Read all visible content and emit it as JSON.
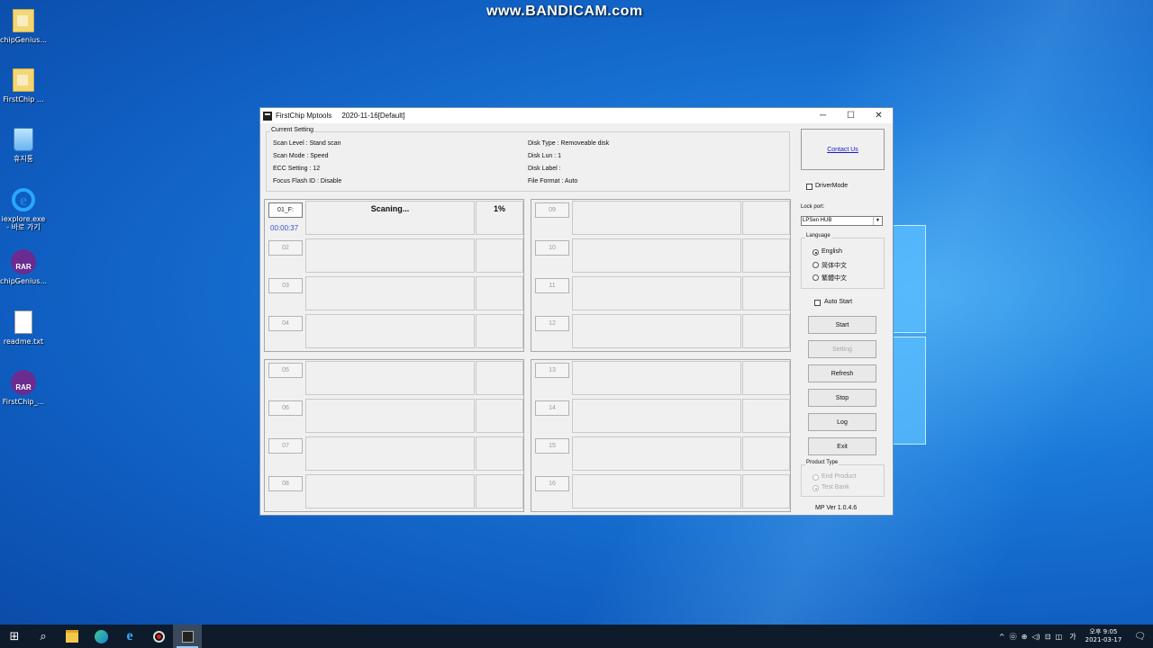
{
  "watermark": "www.BANDICAM.com",
  "desktop_icons": [
    {
      "label": "chipGenius...",
      "icon": "folder-icon"
    },
    {
      "label": "FirstChip ...",
      "icon": "folder-icon"
    },
    {
      "label": "휴지통",
      "icon": "recycle-bin-icon"
    },
    {
      "label": "iexplore.exe - 바로 가기",
      "icon": "internet-explorer-icon"
    },
    {
      "label": "chipGenius...",
      "icon": "winrar-icon"
    },
    {
      "label": "readme.txt",
      "icon": "text-file-icon"
    },
    {
      "label": "FirstChip_...",
      "icon": "winrar-icon"
    }
  ],
  "window": {
    "title": "FirstChip Mptools     2020-11-16[Default]",
    "controls": {
      "minimize": "─",
      "maximize": "☐",
      "close": "✕"
    },
    "current_setting": {
      "title": "Current Setting",
      "left": [
        "Scan Level : Stand scan",
        "Scan Mode : Speed",
        "ECC Setting : 12",
        "Focus Flash ID : Disable"
      ],
      "right": [
        "Disk Type : Removeable disk",
        "Disk Lun : 1",
        "Disk Label :",
        "File Format : Auto"
      ]
    },
    "ports": [
      {
        "label": "01_F:",
        "time": "00:00:37",
        "status": "Scaning...",
        "pct": "1%"
      },
      {
        "label": "02"
      },
      {
        "label": "03"
      },
      {
        "label": "04"
      },
      {
        "label": "05"
      },
      {
        "label": "06"
      },
      {
        "label": "07"
      },
      {
        "label": "08"
      },
      {
        "label": "09"
      },
      {
        "label": "10"
      },
      {
        "label": "11"
      },
      {
        "label": "12"
      },
      {
        "label": "13"
      },
      {
        "label": "14"
      },
      {
        "label": "15"
      },
      {
        "label": "16"
      }
    ],
    "contact_us": "Contact Us",
    "driver_mode": "DriverMode",
    "lock_port": {
      "label": "Lock port:",
      "value": "LPSen HUB"
    },
    "language": {
      "title": "Language",
      "options": [
        "English",
        "简体中文",
        "繁體中文"
      ]
    },
    "auto_start": "Auto Start",
    "buttons": {
      "start": "Start",
      "setting": "Setting",
      "refresh": "Refresh",
      "stop": "Stop",
      "log": "Log",
      "exit": "Exit"
    },
    "product_type": {
      "title": "Product Type",
      "options": [
        "End Product",
        "Test Bank"
      ]
    },
    "version": "MP Ver 1.0.4.6"
  },
  "taskbar": {
    "start": "⊞",
    "search": "⌕",
    "tray_icons": "^  ㉧  ⊕  ◁)  ⊡  ◫",
    "ime": "가",
    "time": "오후 9:05",
    "date": "2021-03-17",
    "notification": "🗨"
  }
}
